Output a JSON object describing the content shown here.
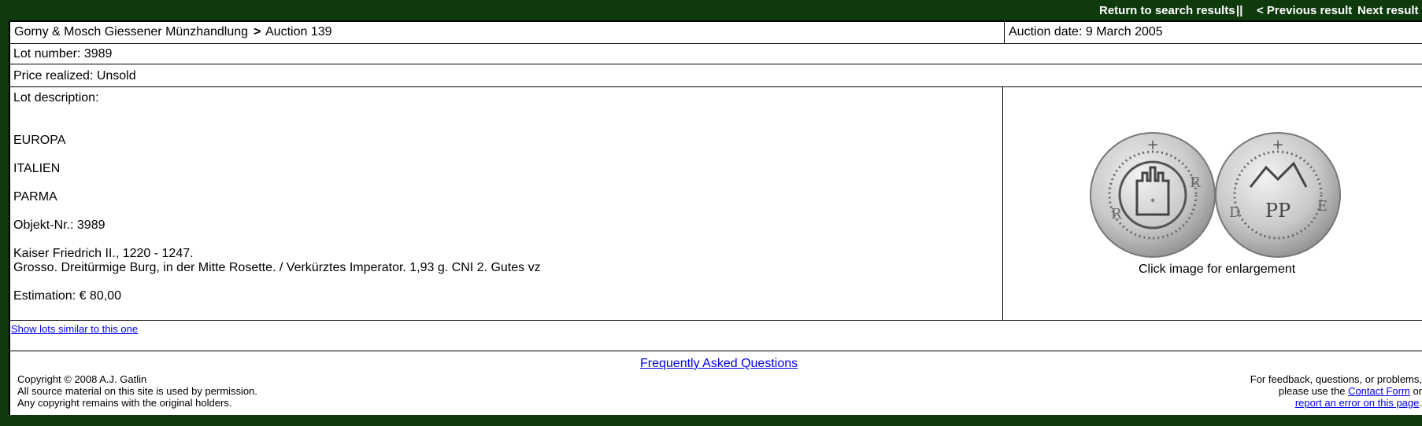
{
  "topnav": {
    "return_label": "Return to search results",
    "separator": "||",
    "previous_label": "< Previous result",
    "next_label": "Next result >"
  },
  "header": {
    "dealer": "Gorny & Mosch Giessener Münzhandlung",
    "arrow": ">",
    "auction": "Auction 139",
    "auction_date": "Auction date: 9 March 2005"
  },
  "lot": {
    "number": "Lot number: 3989",
    "price": "Price realized: Unsold",
    "description_label": "Lot description:",
    "lines": [
      "EUROPA",
      "ITALIEN",
      "PARMA",
      "Objekt-Nr.: 3989",
      "Kaiser Friedrich II., 1220 - 1247.",
      "Grosso. Dreitürmige Burg, in der Mitte Rosette. / Verkürztes Imperator. 1,93 g. CNI 2. Gutes vz",
      "Estimation: € 80,00"
    ],
    "image_caption": "Click image for enlargement"
  },
  "similar_link": "Show lots similar to this one",
  "footer": {
    "faq_label": "Frequently Asked Questions",
    "copyright_lines": [
      "Copyright © 2008  A.J. Gatlin",
      "All source material on this site is used by permission.",
      "Any copyright remains with the original holders."
    ],
    "feedback_line1": "For feedback, questions, or problems,",
    "feedback_line2_prefix": "please use the",
    "contact_form_label": "Contact Form",
    "feedback_line2_suffix": "or",
    "report_error_label": "report an error on this page",
    "feedback_line3_suffix": "."
  },
  "colors": {
    "page_background": "#0e3a0e",
    "link": "#0000ee"
  }
}
